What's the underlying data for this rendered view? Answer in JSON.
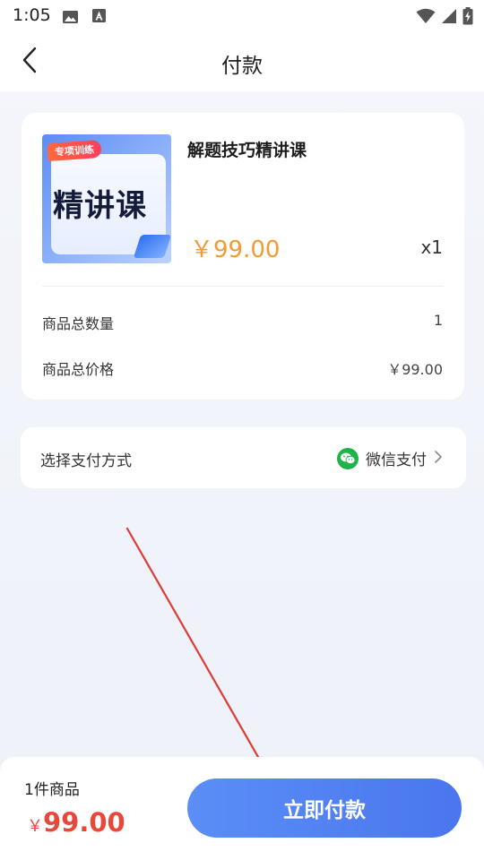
{
  "status_bar": {
    "time": "1:05"
  },
  "nav": {
    "title": "付款"
  },
  "product": {
    "cover_tag": "专项训练",
    "cover_title": "精讲课",
    "name": "解题技巧精讲课",
    "price": "￥99.00",
    "quantity": "x1",
    "rows": [
      {
        "label": "商品总数量",
        "value": "1"
      },
      {
        "label": "商品总价格",
        "value": "￥99.00"
      }
    ]
  },
  "payment": {
    "label": "选择支付方式",
    "method": "微信支付"
  },
  "footer": {
    "item_count": "1件商品",
    "currency_symbol": "￥",
    "total": "99.00",
    "pay_button": "立即付款"
  },
  "colors": {
    "accent_blue": "#4a76ee",
    "price_orange": "#f39a33",
    "total_red": "#e8483a",
    "wechat_green": "#20b34a",
    "annotation_red": "#e03a34"
  }
}
